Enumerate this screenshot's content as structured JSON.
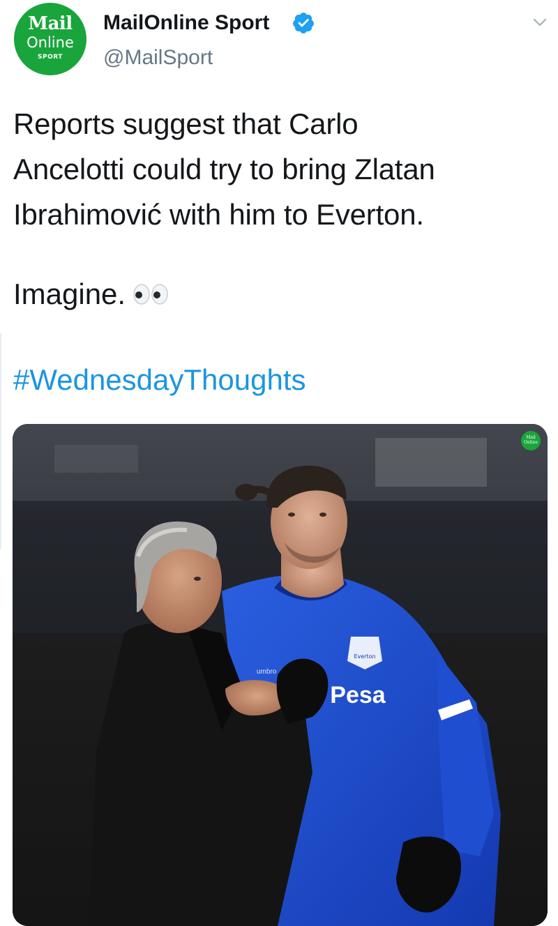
{
  "account": {
    "avatar": {
      "brand_top": "Mail",
      "brand_mid": "Online",
      "brand_sub": "SPORT",
      "color": "#19a53b"
    },
    "display_name": "MailOnline Sport",
    "verified": true,
    "handle": "@MailSport"
  },
  "tweet": {
    "lines": [
      "Reports suggest that Carlo",
      "Ancelotti could try to bring Zlatan",
      "Ibrahimović with him to Everton."
    ],
    "imagine": "Imagine.",
    "emoji": "eyes-icon",
    "hashtag": "#WednesdayThoughts"
  },
  "media": {
    "watermark_top": "Mail",
    "watermark_bottom": "Online",
    "shirt_sponsor": "Pesa",
    "shirt_kit": "umbro",
    "crest_text": "Everton"
  },
  "colors": {
    "link": "#1b95e0",
    "verified": "#1da1f2",
    "text": "#14171a",
    "muted": "#657786",
    "everton_blue": "#1a4fcf"
  },
  "icons": {
    "menu": "chevron-down-icon",
    "verified": "verified-badge-icon"
  }
}
